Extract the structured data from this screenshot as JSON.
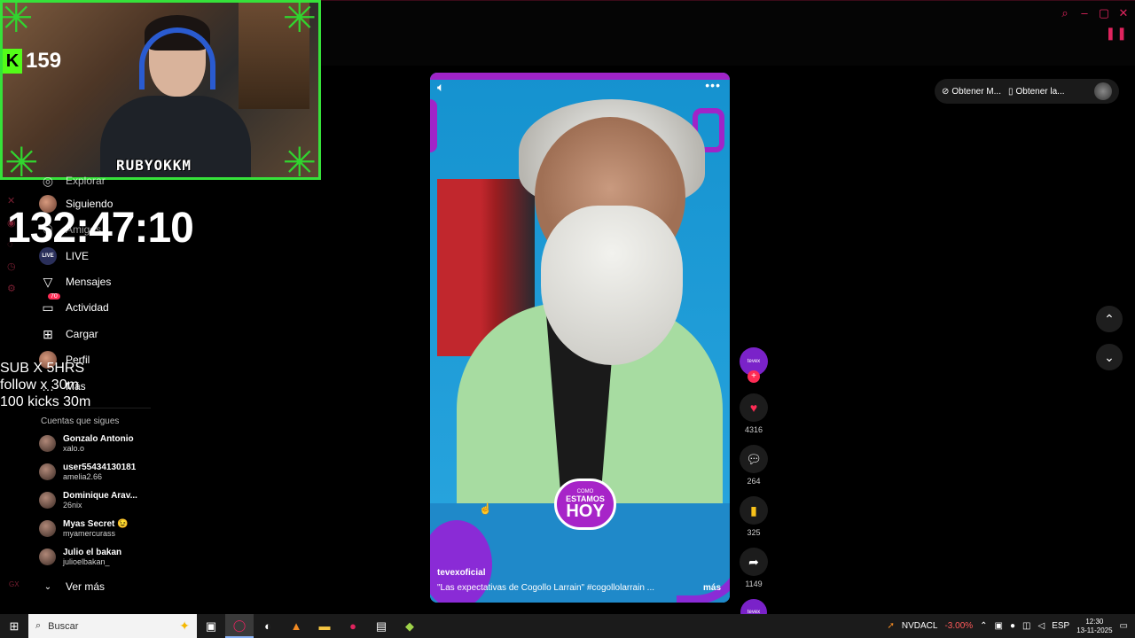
{
  "webcam": {
    "kick_count": "159",
    "streamer_name": "RUBYOKKM"
  },
  "overlay": {
    "timer": "132:47:10",
    "promo_lines": [
      "SUB X 5HRS",
      "follow x 30m",
      "100 kicks 30m"
    ]
  },
  "sidebar": {
    "items": [
      {
        "label": "Explorar",
        "icon": "compass-icon"
      },
      {
        "label": "Siguiendo",
        "icon": "avatar-icon"
      },
      {
        "label": "Amigos",
        "icon": "friends-icon"
      },
      {
        "label": "LIVE",
        "icon": "live-icon"
      },
      {
        "label": "Mensajes",
        "icon": "send-icon"
      },
      {
        "label": "Actividad",
        "icon": "activity-icon",
        "badge": "70"
      },
      {
        "label": "Cargar",
        "icon": "upload-icon"
      },
      {
        "label": "Perfil",
        "icon": "profile-icon"
      },
      {
        "label": "Más",
        "icon": "more-icon"
      }
    ],
    "section_title": "Cuentas que sigues",
    "accounts": [
      {
        "name": "Gonzalo Antonio",
        "handle": "xalo.o"
      },
      {
        "name": "user55434130181",
        "handle": "amelia2.66"
      },
      {
        "name": "Dominique Arav...",
        "handle": "26nix"
      },
      {
        "name": "Myas Secret 😉",
        "handle": "myamercurass"
      },
      {
        "name": "Julio el bakan",
        "handle": "julioelbakan_"
      }
    ],
    "see_more": "Ver más",
    "gx": "GX"
  },
  "video": {
    "username": "tevexoficial",
    "description": "\"Las expectativas de Cogollo Larrain\" #cogollolarrain ...",
    "more_label": "más",
    "logo_small": "COMO",
    "logo_mid": "ESTAMOS",
    "logo_big": "HOY"
  },
  "actions": {
    "creator_label": "tevex",
    "likes": "4316",
    "comments": "264",
    "saves": "325",
    "shares": "1149"
  },
  "top_pills": {
    "pill1": "Obtener M...",
    "pill2": "Obtener la..."
  },
  "taskbar": {
    "search_placeholder": "Buscar",
    "stock_name": "NVDACL",
    "stock_change": "-3.00%",
    "lang": "ESP",
    "time": "12:30",
    "date": "13-11-2025"
  },
  "colors": {
    "accent": "#fe2c55",
    "webcam_border": "#36e23a",
    "kick_green": "#53fc18",
    "brand_purple": "#a024c8"
  }
}
